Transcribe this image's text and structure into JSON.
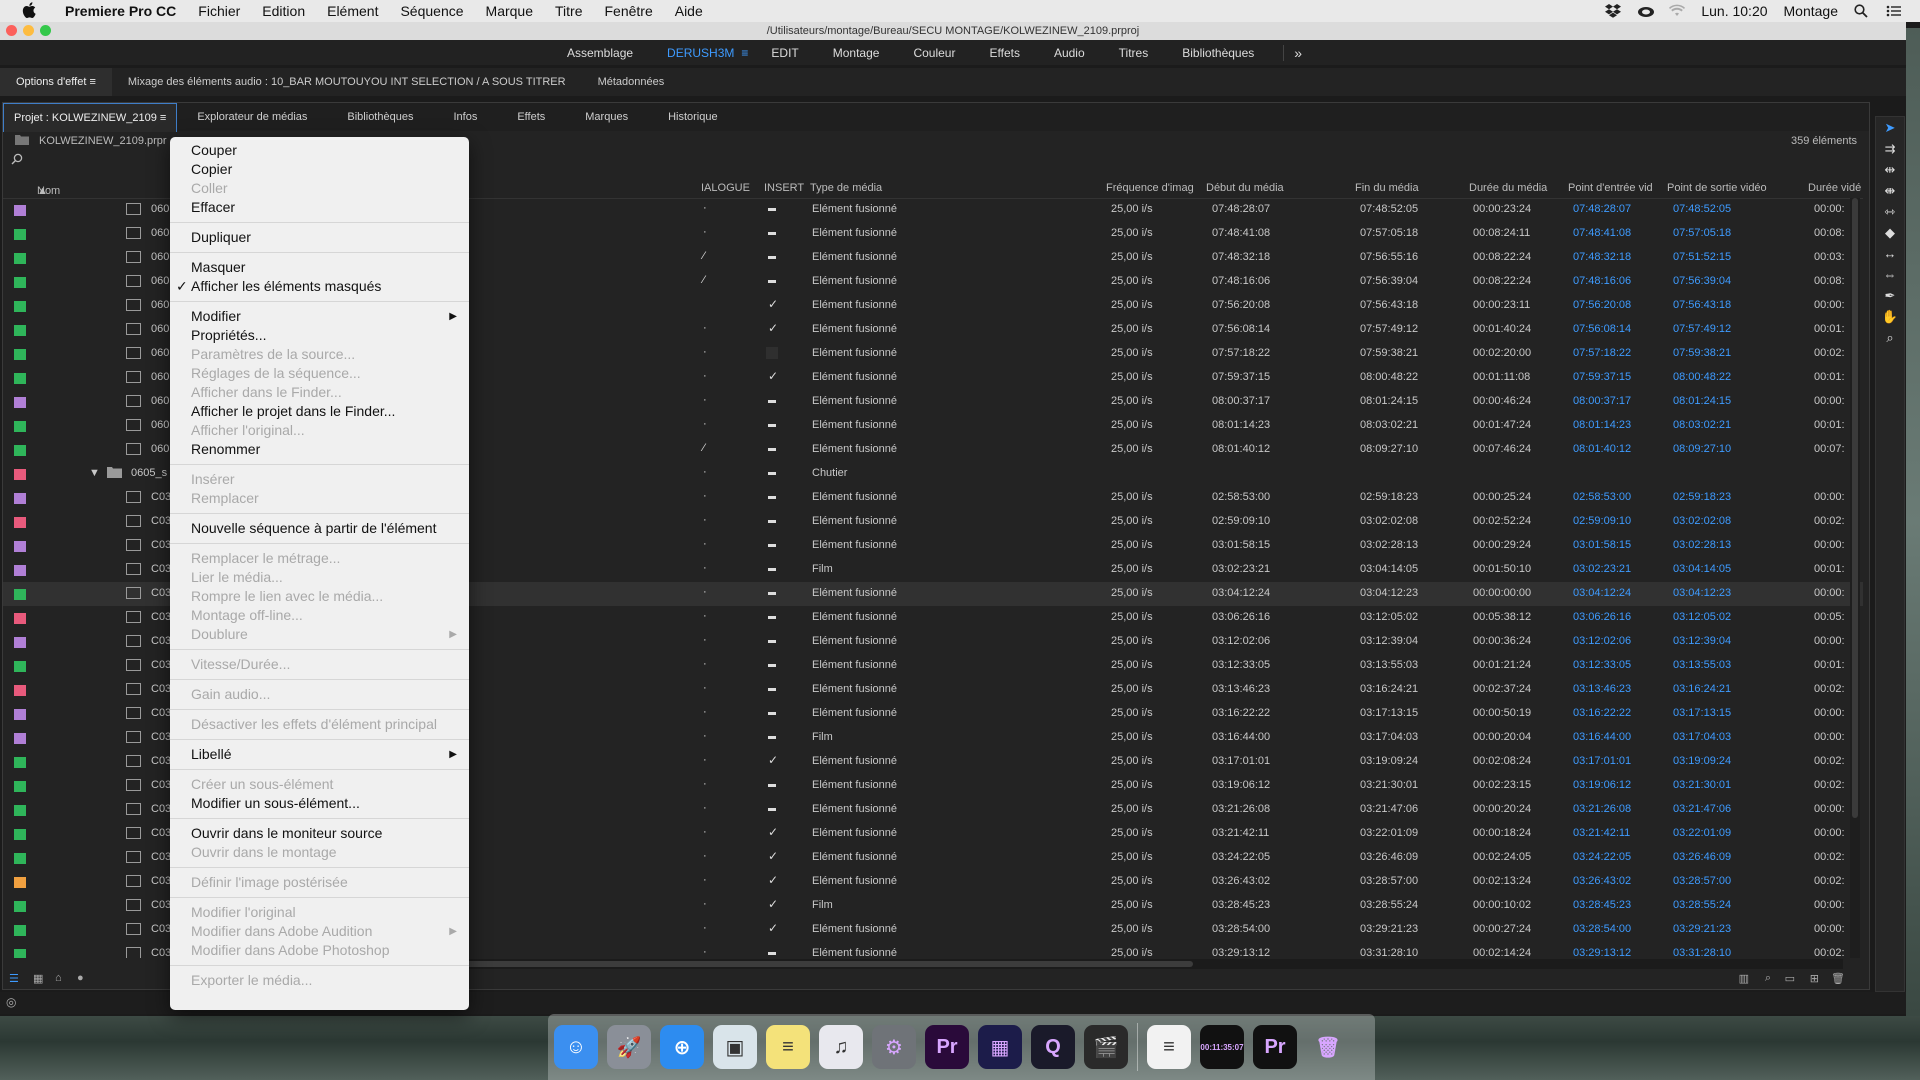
{
  "menubar": {
    "app_name": "Premiere Pro CC",
    "items": [
      "Fichier",
      "Edition",
      "Elément",
      "Séquence",
      "Marque",
      "Titre",
      "Fenêtre",
      "Aide"
    ],
    "clock": "Lun. 10:20",
    "user": "Montage"
  },
  "window": {
    "path": "/Utilisateurs/montage/Bureau/SECU MONTAGE/KOLWEZINEW_2109.prproj"
  },
  "workspaces": {
    "items": [
      "Assemblage",
      "DERUSH3M",
      "EDIT",
      "Montage",
      "Couleur",
      "Effets",
      "Audio",
      "Titres",
      "Bibliothèques"
    ],
    "active": "DERUSH3M",
    "more": "»"
  },
  "upper_tabs": [
    "Options d'effet",
    "Mixage des éléments audio : 10_BAR MOUTOUYOU INT SELECTION / A SOUS TITRER",
    "Métadonnées"
  ],
  "project_tabs": [
    "Projet : KOLWEZINEW_2109",
    "Explorateur de médias",
    "Bibliothèques",
    "Infos",
    "Effets",
    "Marques",
    "Historique"
  ],
  "project": {
    "file": "KOLWEZINEW_2109.prpr",
    "count": "359 éléments"
  },
  "columns": {
    "name": "Nom",
    "dialogue": "IALOGUE",
    "insert": "INSERT",
    "media_type": "Type de média",
    "fps": "Fréquence d'imag",
    "media_start": "Début du média",
    "media_end": "Fin du média",
    "media_duration": "Durée du média",
    "video_in": "Point d'entrée vid",
    "video_out": "Point de sortie vidéo",
    "video_duration": "Durée vidé"
  },
  "rows": [
    {
      "name": "060",
      "color": "#b07fd6",
      "dlg": "·",
      "ins": "-",
      "type": "Elément fusionné",
      "fps": "25,00 i/s",
      "start": "07:48:28:07",
      "end": "07:48:52:05",
      "dur": "00:00:23:24",
      "in": "07:48:28:07",
      "out": "07:48:52:05",
      "vdur": "00:00:"
    },
    {
      "name": "060",
      "color": "#2fb55a",
      "dlg": "·",
      "ins": "-",
      "type": "Elément fusionné",
      "fps": "25,00 i/s",
      "start": "07:48:41:08",
      "end": "07:57:05:18",
      "dur": "00:08:24:11",
      "in": "07:48:41:08",
      "out": "07:57:05:18",
      "vdur": "00:08:"
    },
    {
      "name": "060",
      "color": "#2fb55a",
      "dlg": "⁄",
      "ins": "-",
      "type": "Elément fusionné",
      "fps": "25,00 i/s",
      "start": "07:48:32:18",
      "end": "07:56:55:16",
      "dur": "00:08:22:24",
      "in": "07:48:32:18",
      "out": "07:51:52:15",
      "vdur": "00:03:"
    },
    {
      "name": "060",
      "color": "#2fb55a",
      "dlg": "⁄",
      "ins": "-",
      "type": "Elément fusionné",
      "fps": "25,00 i/s",
      "start": "07:48:16:06",
      "end": "07:56:39:04",
      "dur": "00:08:22:24",
      "in": "07:48:16:06",
      "out": "07:56:39:04",
      "vdur": "00:08:"
    },
    {
      "name": "060",
      "color": "#2fb55a",
      "dlg": "",
      "ins": "✓",
      "type": "Elément fusionné",
      "fps": "25,00 i/s",
      "start": "07:56:20:08",
      "end": "07:56:43:18",
      "dur": "00:00:23:11",
      "in": "07:56:20:08",
      "out": "07:56:43:18",
      "vdur": "00:00:"
    },
    {
      "name": "060",
      "color": "#2fb55a",
      "dlg": "·",
      "ins": "✓",
      "type": "Elément fusionné",
      "fps": "25,00 i/s",
      "start": "07:56:08:14",
      "end": "07:57:49:12",
      "dur": "00:01:40:24",
      "in": "07:56:08:14",
      "out": "07:57:49:12",
      "vdur": "00:01:"
    },
    {
      "name": "060",
      "color": "#2fb55a",
      "dlg": "·",
      "ins": "",
      "type": "Elément fusionné",
      "fps": "25,00 i/s",
      "start": "07:57:18:22",
      "end": "07:59:38:21",
      "dur": "00:02:20:00",
      "in": "07:57:18:22",
      "out": "07:59:38:21",
      "vdur": "00:02:"
    },
    {
      "name": "060",
      "color": "#2fb55a",
      "dlg": "·",
      "ins": "✓",
      "type": "Elément fusionné",
      "fps": "25,00 i/s",
      "start": "07:59:37:15",
      "end": "08:00:48:22",
      "dur": "00:01:11:08",
      "in": "07:59:37:15",
      "out": "08:00:48:22",
      "vdur": "00:01:"
    },
    {
      "name": "060",
      "color": "#b07fd6",
      "dlg": "·",
      "ins": "-",
      "type": "Elément fusionné",
      "fps": "25,00 i/s",
      "start": "08:00:37:17",
      "end": "08:01:24:15",
      "dur": "00:00:46:24",
      "in": "08:00:37:17",
      "out": "08:01:24:15",
      "vdur": "00:00:"
    },
    {
      "name": "060",
      "color": "#2fb55a",
      "dlg": "·",
      "ins": "-",
      "type": "Elément fusionné",
      "fps": "25,00 i/s",
      "start": "08:01:14:23",
      "end": "08:03:02:21",
      "dur": "00:01:47:24",
      "in": "08:01:14:23",
      "out": "08:03:02:21",
      "vdur": "00:01:"
    },
    {
      "name": "060",
      "color": "#2fb55a",
      "dlg": "⁄",
      "ins": "-",
      "type": "Elément fusionné",
      "fps": "25,00 i/s",
      "start": "08:01:40:12",
      "end": "08:09:27:10",
      "dur": "00:07:46:24",
      "in": "08:01:40:12",
      "out": "08:09:27:10",
      "vdur": "00:07:"
    },
    {
      "name": "0605_s",
      "color": "#e85a7c",
      "dlg": "·",
      "ins": "-",
      "type": "Chutier",
      "fps": "",
      "start": "",
      "end": "",
      "dur": "",
      "in": "",
      "out": "",
      "vdur": "",
      "bin": true
    },
    {
      "name": "C03",
      "color": "#b07fd6",
      "dlg": "·",
      "ins": "-",
      "type": "Elément fusionné",
      "fps": "25,00 i/s",
      "start": "02:58:53:00",
      "end": "02:59:18:23",
      "dur": "00:00:25:24",
      "in": "02:58:53:00",
      "out": "02:59:18:23",
      "vdur": "00:00:"
    },
    {
      "name": "C03",
      "color": "#e85a7c",
      "dlg": "·",
      "ins": "-",
      "type": "Elément fusionné",
      "fps": "25,00 i/s",
      "start": "02:59:09:10",
      "end": "03:02:02:08",
      "dur": "00:02:52:24",
      "in": "02:59:09:10",
      "out": "03:02:02:08",
      "vdur": "00:02:"
    },
    {
      "name": "C03",
      "color": "#b07fd6",
      "dlg": "·",
      "ins": "-",
      "type": "Elément fusionné",
      "fps": "25,00 i/s",
      "start": "03:01:58:15",
      "end": "03:02:28:13",
      "dur": "00:00:29:24",
      "in": "03:01:58:15",
      "out": "03:02:28:13",
      "vdur": "00:00:"
    },
    {
      "name": "C03",
      "color": "#b07fd6",
      "dlg": "·",
      "ins": "-",
      "type": "Film",
      "fps": "25,00 i/s",
      "start": "03:02:23:21",
      "end": "03:04:14:05",
      "dur": "00:01:50:10",
      "in": "03:02:23:21",
      "out": "03:04:14:05",
      "vdur": "00:01:"
    },
    {
      "name": "C03",
      "color": "#2fb55a",
      "dlg": "·",
      "ins": "-",
      "type": "Elément fusionné",
      "fps": "25,00 i/s",
      "start": "03:04:12:24",
      "end": "03:04:12:23",
      "dur": "00:00:00:00",
      "in": "03:04:12:24",
      "out": "03:04:12:23",
      "vdur": "00:00:",
      "hl": true
    },
    {
      "name": "C03",
      "color": "#e85a7c",
      "dlg": "·",
      "ins": "-",
      "type": "Elément fusionné",
      "fps": "25,00 i/s",
      "start": "03:06:26:16",
      "end": "03:12:05:02",
      "dur": "00:05:38:12",
      "in": "03:06:26:16",
      "out": "03:12:05:02",
      "vdur": "00:05:"
    },
    {
      "name": "C03",
      "color": "#b07fd6",
      "dlg": "·",
      "ins": "-",
      "type": "Elément fusionné",
      "fps": "25,00 i/s",
      "start": "03:12:02:06",
      "end": "03:12:39:04",
      "dur": "00:00:36:24",
      "in": "03:12:02:06",
      "out": "03:12:39:04",
      "vdur": "00:00:"
    },
    {
      "name": "C03",
      "color": "#2fb55a",
      "dlg": "·",
      "ins": "-",
      "type": "Elément fusionné",
      "fps": "25,00 i/s",
      "start": "03:12:33:05",
      "end": "03:13:55:03",
      "dur": "00:01:21:24",
      "in": "03:12:33:05",
      "out": "03:13:55:03",
      "vdur": "00:01:"
    },
    {
      "name": "C03",
      "color": "#e85a7c",
      "dlg": "·",
      "ins": "-",
      "type": "Elément fusionné",
      "fps": "25,00 i/s",
      "start": "03:13:46:23",
      "end": "03:16:24:21",
      "dur": "00:02:37:24",
      "in": "03:13:46:23",
      "out": "03:16:24:21",
      "vdur": "00:02:"
    },
    {
      "name": "C03",
      "color": "#b07fd6",
      "dlg": "·",
      "ins": "-",
      "type": "Elément fusionné",
      "fps": "25,00 i/s",
      "start": "03:16:22:22",
      "end": "03:17:13:15",
      "dur": "00:00:50:19",
      "in": "03:16:22:22",
      "out": "03:17:13:15",
      "vdur": "00:00:"
    },
    {
      "name": "C03",
      "color": "#b07fd6",
      "dlg": "·",
      "ins": "-",
      "type": "Film",
      "fps": "25,00 i/s",
      "start": "03:16:44:00",
      "end": "03:17:04:03",
      "dur": "00:00:20:04",
      "in": "03:16:44:00",
      "out": "03:17:04:03",
      "vdur": "00:00:"
    },
    {
      "name": "C03",
      "color": "#2fb55a",
      "dlg": "·",
      "ins": "✓",
      "type": "Elément fusionné",
      "fps": "25,00 i/s",
      "start": "03:17:01:01",
      "end": "03:19:09:24",
      "dur": "00:02:08:24",
      "in": "03:17:01:01",
      "out": "03:19:09:24",
      "vdur": "00:02:"
    },
    {
      "name": "C03",
      "color": "#2fb55a",
      "dlg": "·",
      "ins": "-",
      "type": "Elément fusionné",
      "fps": "25,00 i/s",
      "start": "03:19:06:12",
      "end": "03:21:30:01",
      "dur": "00:02:23:15",
      "in": "03:19:06:12",
      "out": "03:21:30:01",
      "vdur": "00:02:"
    },
    {
      "name": "C03",
      "color": "#2fb55a",
      "dlg": "·",
      "ins": "-",
      "type": "Elément fusionné",
      "fps": "25,00 i/s",
      "start": "03:21:26:08",
      "end": "03:21:47:06",
      "dur": "00:00:20:24",
      "in": "03:21:26:08",
      "out": "03:21:47:06",
      "vdur": "00:00:"
    },
    {
      "name": "C03",
      "color": "#2fb55a",
      "dlg": "·",
      "ins": "✓",
      "type": "Elément fusionné",
      "fps": "25,00 i/s",
      "start": "03:21:42:11",
      "end": "03:22:01:09",
      "dur": "00:00:18:24",
      "in": "03:21:42:11",
      "out": "03:22:01:09",
      "vdur": "00:00:"
    },
    {
      "name": "C03",
      "color": "#2fb55a",
      "dlg": "·",
      "ins": "✓",
      "type": "Elément fusionné",
      "fps": "25,00 i/s",
      "start": "03:24:22:05",
      "end": "03:26:46:09",
      "dur": "00:02:24:05",
      "in": "03:24:22:05",
      "out": "03:26:46:09",
      "vdur": "00:02:"
    },
    {
      "name": "C03",
      "color": "#f0a040",
      "dlg": "·",
      "ins": "✓",
      "type": "Elément fusionné",
      "fps": "25,00 i/s",
      "start": "03:26:43:02",
      "end": "03:28:57:00",
      "dur": "00:02:13:24",
      "in": "03:26:43:02",
      "out": "03:28:57:00",
      "vdur": "00:02:"
    },
    {
      "name": "C03",
      "color": "#2fb55a",
      "dlg": "·",
      "ins": "✓",
      "type": "Film",
      "fps": "25,00 i/s",
      "start": "03:28:45:23",
      "end": "03:28:55:24",
      "dur": "00:00:10:02",
      "in": "03:28:45:23",
      "out": "03:28:55:24",
      "vdur": "00:00:"
    },
    {
      "name": "C03",
      "color": "#2fb55a",
      "dlg": "·",
      "ins": "✓",
      "type": "Elément fusionné",
      "fps": "25,00 i/s",
      "start": "03:28:54:00",
      "end": "03:29:21:23",
      "dur": "00:00:27:24",
      "in": "03:28:54:00",
      "out": "03:29:21:23",
      "vdur": "00:00:"
    },
    {
      "name": "C03",
      "color": "#2fb55a",
      "dlg": "·",
      "ins": "-",
      "type": "Elément fusionné",
      "fps": "25,00 i/s",
      "start": "03:29:13:12",
      "end": "03:31:28:10",
      "dur": "00:02:14:24",
      "in": "03:29:13:12",
      "out": "03:31:28:10",
      "vdur": "00:02:"
    }
  ],
  "context_menu": [
    {
      "label": "Couper",
      "enabled": true
    },
    {
      "label": "Copier",
      "enabled": true
    },
    {
      "label": "Coller",
      "enabled": false
    },
    {
      "label": "Effacer",
      "enabled": true
    },
    {
      "sep": true
    },
    {
      "label": "Dupliquer",
      "enabled": true
    },
    {
      "sep": true
    },
    {
      "label": "Masquer",
      "enabled": true
    },
    {
      "label": "Afficher les éléments masqués",
      "enabled": true,
      "checked": true
    },
    {
      "sep": true
    },
    {
      "label": "Modifier",
      "enabled": true,
      "submenu": true
    },
    {
      "label": "Propriétés...",
      "enabled": true
    },
    {
      "label": "Paramètres de la source...",
      "enabled": false
    },
    {
      "label": "Réglages de la séquence...",
      "enabled": false
    },
    {
      "label": "Afficher dans le Finder...",
      "enabled": false
    },
    {
      "label": "Afficher le projet dans le Finder...",
      "enabled": true
    },
    {
      "label": "Afficher l'original...",
      "enabled": false
    },
    {
      "label": "Renommer",
      "enabled": true
    },
    {
      "sep": true
    },
    {
      "label": "Insérer",
      "enabled": false
    },
    {
      "label": "Remplacer",
      "enabled": false
    },
    {
      "sep": true
    },
    {
      "label": "Nouvelle séquence à partir de l'élément",
      "enabled": true
    },
    {
      "sep": true
    },
    {
      "label": "Remplacer le métrage...",
      "enabled": false
    },
    {
      "label": "Lier le média...",
      "enabled": false
    },
    {
      "label": "Rompre le lien avec le média...",
      "enabled": false
    },
    {
      "label": "Montage off-line...",
      "enabled": false
    },
    {
      "label": "Doublure",
      "enabled": false,
      "submenu": true
    },
    {
      "sep": true
    },
    {
      "label": "Vitesse/Durée...",
      "enabled": false
    },
    {
      "sep": true
    },
    {
      "label": "Gain audio...",
      "enabled": false
    },
    {
      "sep": true
    },
    {
      "label": "Désactiver les effets d'élément principal",
      "enabled": false
    },
    {
      "sep": true
    },
    {
      "label": "Libellé",
      "enabled": true,
      "submenu": true
    },
    {
      "sep": true
    },
    {
      "label": "Créer un sous-élément",
      "enabled": false
    },
    {
      "label": "Modifier un sous-élément...",
      "enabled": true
    },
    {
      "sep": true
    },
    {
      "label": "Ouvrir dans le moniteur source",
      "enabled": true
    },
    {
      "label": "Ouvrir dans le montage",
      "enabled": false
    },
    {
      "sep": true
    },
    {
      "label": "Définir l'image postérisée",
      "enabled": false
    },
    {
      "sep": true
    },
    {
      "label": "Modifier l'original",
      "enabled": false
    },
    {
      "label": "Modifier dans Adobe Audition",
      "enabled": false,
      "submenu": true
    },
    {
      "label": "Modifier dans Adobe Photoshop",
      "enabled": false
    },
    {
      "sep": true
    },
    {
      "label": "Exporter le média...",
      "enabled": false
    }
  ],
  "dock": [
    {
      "icon": "finder-icon",
      "glyph": "☺",
      "bg": "#3b8ff0"
    },
    {
      "icon": "launchpad-icon",
      "glyph": "🚀",
      "bg": "#8a8f98"
    },
    {
      "icon": "safari-icon",
      "glyph": "⊕",
      "bg": "#2d8cf0"
    },
    {
      "icon": "preview-icon",
      "glyph": "▣",
      "bg": "#d9e4ea"
    },
    {
      "icon": "notes-icon",
      "glyph": "≡",
      "bg": "#f4e27a"
    },
    {
      "icon": "itunes-icon",
      "glyph": "♫",
      "bg": "#e8e8ee"
    },
    {
      "icon": "system-preferences-icon",
      "glyph": "⚙",
      "bg": "#6f7378"
    },
    {
      "icon": "premiere-pro-icon",
      "glyph": "Pr",
      "bg": "#2a0a3a"
    },
    {
      "icon": "media-encoder-icon",
      "glyph": "▦",
      "bg": "#1c1c4a"
    },
    {
      "icon": "quicktime-icon",
      "glyph": "Q",
      "bg": "#1a1a2a"
    },
    {
      "icon": "clapper-icon",
      "glyph": "🎬",
      "bg": "#2a2a2a"
    },
    {
      "sep": true
    },
    {
      "icon": "document-icon",
      "glyph": "≡",
      "bg": "#f2f2f2"
    },
    {
      "icon": "premiere-timecode-icon",
      "glyph": "00:11:35:07",
      "bg": "#111"
    },
    {
      "icon": "premiere-window-icon",
      "glyph": "Pr",
      "bg": "#111"
    },
    {
      "icon": "trash-icon",
      "glyph": "🗑",
      "bg": "transparent"
    }
  ]
}
